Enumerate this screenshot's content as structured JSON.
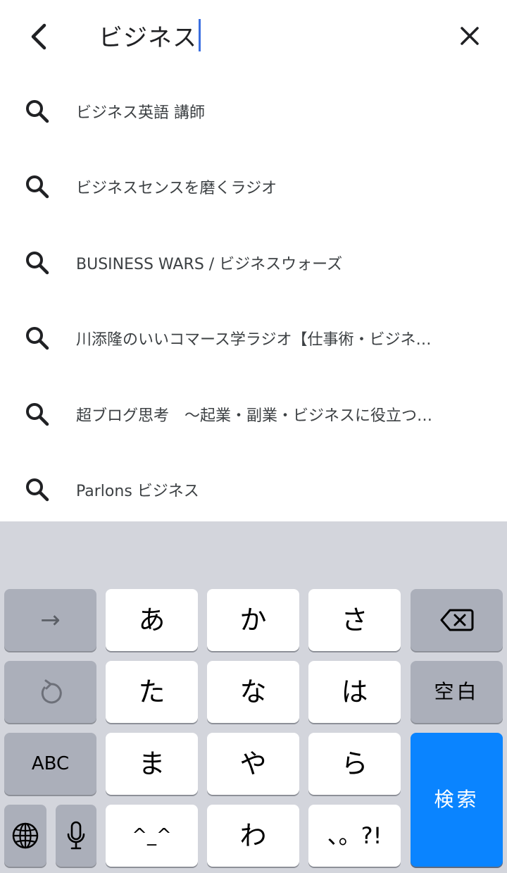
{
  "search": {
    "query": "ビジネス"
  },
  "suggestions": [
    {
      "label": "ビジネス英語 講師"
    },
    {
      "label": "ビジネスセンスを磨くラジオ"
    },
    {
      "label": "BUSINESS WARS / ビジネスウォーズ"
    },
    {
      "label": "川添隆のいいコマース学ラジオ【仕事術・ビジネ…"
    },
    {
      "label": "超ブログ思考　〜起業・副業・ビジネスに役立つ…"
    },
    {
      "label": "Parlons ビジネス"
    }
  ],
  "keyboard": {
    "row1": {
      "next": "→",
      "a": "あ",
      "ka": "か",
      "sa": "さ"
    },
    "row2": {
      "ta": "た",
      "na": "な",
      "ha": "は",
      "space": "空白"
    },
    "row3": {
      "abc": "ABC",
      "ma": "ま",
      "ya": "や",
      "ra": "ら"
    },
    "row4": {
      "kaomoji": "^_^",
      "wa": "わ",
      "punct": "、。?!"
    },
    "search_key": "検索"
  },
  "colors": {
    "caret": "#3b6fe0",
    "keyboard_bg": "#d3d5dc",
    "key_white": "#ffffff",
    "key_gray": "#abafba",
    "key_blue": "#0a84ff"
  }
}
